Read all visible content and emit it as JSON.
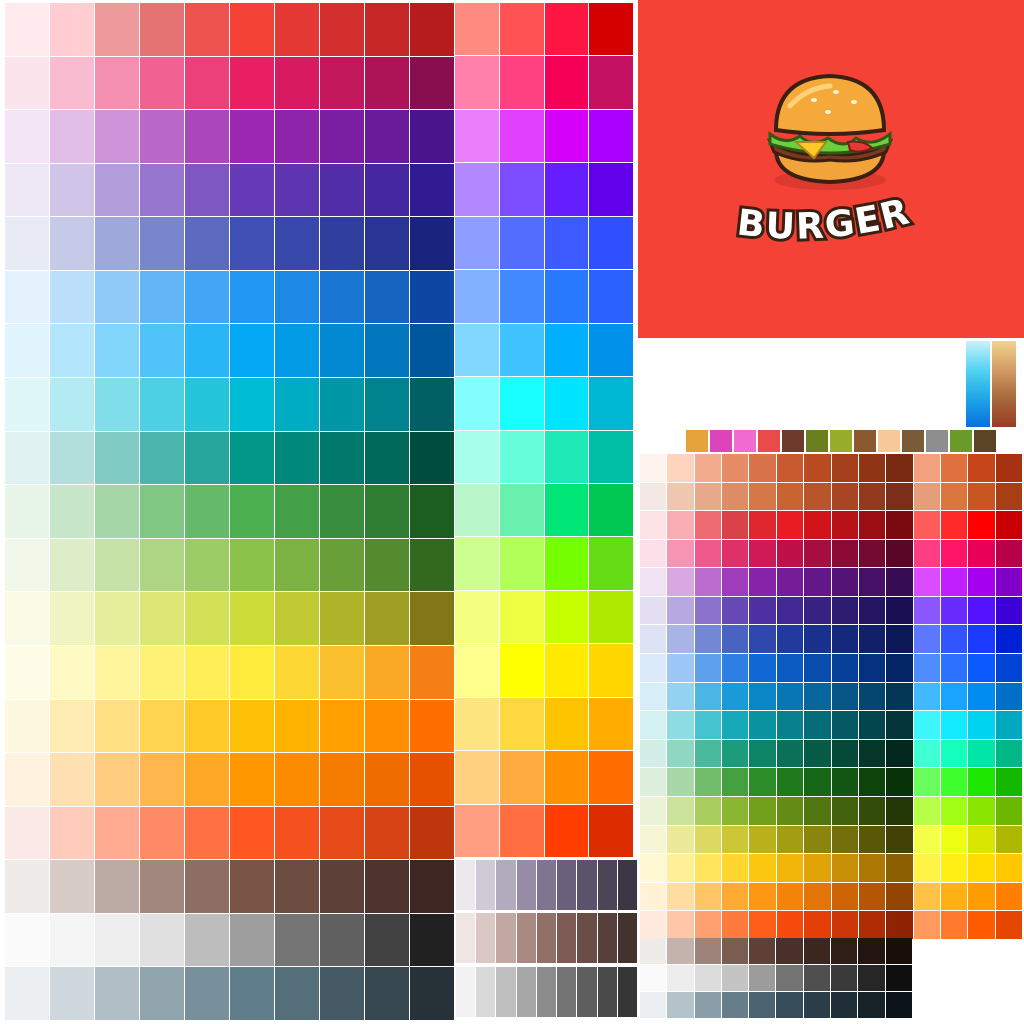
{
  "brand": {
    "name": "BURGER",
    "panel_color": "#f44336",
    "logo_icon": "burger-icon"
  },
  "gradients": [
    {
      "name": "blue-gradient",
      "from": "#c9f3fb",
      "to": "#0a6fe0"
    },
    {
      "name": "tan-gradient",
      "from": "#f1d48a",
      "to": "#9a3b22"
    }
  ],
  "swatch_strip": [
    "#e5a13a",
    "#dd44bb",
    "#f06ad2",
    "#ea4a4a",
    "#6e3a2a",
    "#6b7f1f",
    "#98ae2a",
    "#8a5a2e",
    "#f7c89a",
    "#7a5a38",
    "#8e8e8e",
    "#6a9a28",
    "#5a4426"
  ],
  "main_palette": {
    "columns": 10,
    "rows": [
      [
        "#ffebee",
        "#ffcdd2",
        "#ef9a9a",
        "#e57373",
        "#ef5350",
        "#f44336",
        "#e53935",
        "#d32f2f",
        "#c62828",
        "#b71c1c"
      ],
      [
        "#fce4ec",
        "#f8bbd0",
        "#f48fb1",
        "#f06292",
        "#ec407a",
        "#e91e63",
        "#d81b60",
        "#c2185b",
        "#ad1457",
        "#880e4f"
      ],
      [
        "#f3e5f5",
        "#e1bee7",
        "#ce93d8",
        "#ba68c8",
        "#ab47bc",
        "#9c27b0",
        "#8e24aa",
        "#7b1fa2",
        "#6a1b9a",
        "#4a148c"
      ],
      [
        "#ede7f6",
        "#d1c4e9",
        "#b39ddb",
        "#9575cd",
        "#7e57c2",
        "#673ab7",
        "#5e35b1",
        "#512da8",
        "#4527a0",
        "#311b92"
      ],
      [
        "#e8eaf6",
        "#c5cae9",
        "#9fa8da",
        "#7986cb",
        "#5c6bc0",
        "#3f51b5",
        "#3949ab",
        "#303f9f",
        "#283593",
        "#1a237e"
      ],
      [
        "#e3f2fd",
        "#bbdefb",
        "#90caf9",
        "#64b5f6",
        "#42a5f5",
        "#2196f3",
        "#1e88e5",
        "#1976d2",
        "#1565c0",
        "#0d47a1"
      ],
      [
        "#e1f5fe",
        "#b3e5fc",
        "#81d4fa",
        "#4fc3f7",
        "#29b6f6",
        "#03a9f4",
        "#039be5",
        "#0288d1",
        "#0277bd",
        "#01579b"
      ],
      [
        "#e0f7fa",
        "#b2ebf2",
        "#80deea",
        "#4dd0e1",
        "#26c6da",
        "#00bcd4",
        "#00acc1",
        "#0097a7",
        "#00838f",
        "#006064"
      ],
      [
        "#e0f2f1",
        "#b2dfdb",
        "#80cbc4",
        "#4db6ac",
        "#26a69a",
        "#009688",
        "#00897b",
        "#00796b",
        "#00695c",
        "#004d40"
      ],
      [
        "#e8f5e9",
        "#c8e6c9",
        "#a5d6a7",
        "#81c784",
        "#66bb6a",
        "#4caf50",
        "#43a047",
        "#388e3c",
        "#2e7d32",
        "#1b5e20"
      ],
      [
        "#f1f8e9",
        "#dcedc8",
        "#c5e1a5",
        "#aed581",
        "#9ccc65",
        "#8bc34a",
        "#7cb342",
        "#689f38",
        "#558b2f",
        "#33691e"
      ],
      [
        "#f9fbe7",
        "#f0f4c3",
        "#e6ee9c",
        "#dce775",
        "#d4e157",
        "#cddc39",
        "#c0ca33",
        "#afb42b",
        "#9e9d24",
        "#827717"
      ],
      [
        "#fffde7",
        "#fff9c4",
        "#fff59d",
        "#fff176",
        "#ffee58",
        "#ffeb3b",
        "#fdd835",
        "#fbc02d",
        "#f9a825",
        "#f57f17"
      ],
      [
        "#fff8e1",
        "#ffecb3",
        "#ffe082",
        "#ffd54f",
        "#ffca28",
        "#ffc107",
        "#ffb300",
        "#ffa000",
        "#ff8f00",
        "#ff6f00"
      ],
      [
        "#fff3e0",
        "#ffe0b2",
        "#ffcc80",
        "#ffb74d",
        "#ffa726",
        "#ff9800",
        "#fb8c00",
        "#f57c00",
        "#ef6c00",
        "#e65100"
      ],
      [
        "#fbe9e7",
        "#ffccbc",
        "#ffab91",
        "#ff8a65",
        "#ff7043",
        "#ff5722",
        "#f4511e",
        "#e64a19",
        "#d84315",
        "#bf360c"
      ],
      [
        "#efebe9",
        "#d7ccc8",
        "#bcaaa4",
        "#a1887f",
        "#8d6e63",
        "#795548",
        "#6d4c41",
        "#5d4037",
        "#4e342e",
        "#3e2723"
      ],
      [
        "#fafafa",
        "#f5f5f5",
        "#eeeeee",
        "#e0e0e0",
        "#bdbdbd",
        "#9e9e9e",
        "#757575",
        "#616161",
        "#424242",
        "#212121"
      ],
      [
        "#eceff1",
        "#cfd8dc",
        "#b0bec5",
        "#90a4ae",
        "#78909c",
        "#607d8b",
        "#546e7a",
        "#455a64",
        "#37474f",
        "#263238"
      ]
    ]
  },
  "accent_palette": {
    "columns": 4,
    "rows": [
      [
        "#ff8a80",
        "#ff5252",
        "#ff1744",
        "#d50000"
      ],
      [
        "#ff80ab",
        "#ff4081",
        "#f50057",
        "#c51162"
      ],
      [
        "#ea80fc",
        "#e040fb",
        "#d500f9",
        "#aa00ff"
      ],
      [
        "#b388ff",
        "#7c4dff",
        "#651fff",
        "#6200ea"
      ],
      [
        "#8c9eff",
        "#536dfe",
        "#3d5afe",
        "#304ffe"
      ],
      [
        "#82b1ff",
        "#448aff",
        "#2979ff",
        "#2962ff"
      ],
      [
        "#80d8ff",
        "#40c4ff",
        "#00b0ff",
        "#0091ea"
      ],
      [
        "#84ffff",
        "#18ffff",
        "#00e5ff",
        "#00b8d4"
      ],
      [
        "#a7ffeb",
        "#64ffda",
        "#1de9b6",
        "#00bfa5"
      ],
      [
        "#b9f6ca",
        "#69f0ae",
        "#00e676",
        "#00c853"
      ],
      [
        "#ccff90",
        "#b2ff59",
        "#76ff03",
        "#64dd17"
      ],
      [
        "#f4ff81",
        "#eeff41",
        "#c6ff00",
        "#aeea00"
      ],
      [
        "#ffff8d",
        "#ffff00",
        "#ffea00",
        "#ffd600"
      ],
      [
        "#ffe57f",
        "#ffd740",
        "#ffc400",
        "#ffab00"
      ],
      [
        "#ffd180",
        "#ffab40",
        "#ff9100",
        "#ff6d00"
      ],
      [
        "#ff9e80",
        "#ff6e40",
        "#ff3d00",
        "#dd2c00"
      ]
    ]
  },
  "small_gray_palette": {
    "columns": 9,
    "rows": [
      [
        "#ebe9ee",
        "#cfcad6",
        "#b2abbd",
        "#968ca5",
        "#7f7491",
        "#6a607c",
        "#5b536c",
        "#4c4558",
        "#3c3745"
      ],
      [
        "#efe6e4",
        "#d9c8c4",
        "#c1a8a2",
        "#a88a82",
        "#927068",
        "#7d5a53",
        "#6b4d47",
        "#57403b",
        "#43322e"
      ],
      [
        "#f2f2f2",
        "#d9d9d9",
        "#bfbfbf",
        "#a6a6a6",
        "#8c8c8c",
        "#737373",
        "#5e5e5e",
        "#4a4a4a",
        "#363636"
      ]
    ]
  },
  "right_palette": {
    "columns": 14,
    "rows": [
      [
        "#fff3ee",
        "#ffd4bf",
        "#f2ab8c",
        "#e68c66",
        "#d9734b",
        "#c9592e",
        "#b94b22",
        "#a53e1b",
        "#8f3415",
        "#7a2a10",
        "#f2a07d",
        "#e0703e",
        "#c7451a",
        "#a8320f"
      ],
      [
        "#f4e8e4",
        "#efc7b0",
        "#e7a98a",
        "#dd8c66",
        "#d57847",
        "#c86332",
        "#b9552b",
        "#a84624",
        "#93391d",
        "#7d2e18",
        "#e59d7a",
        "#d9773e",
        "#c75620",
        "#a63f15"
      ],
      [
        "#fde3e6",
        "#f9aeb6",
        "#ee6b74",
        "#d94249",
        "#e0272d",
        "#ea1c23",
        "#d3131a",
        "#b71016",
        "#9a0d12",
        "#7a0a0e",
        "#ff5c5c",
        "#ff2a2a",
        "#ff0000",
        "#c80000"
      ],
      [
        "#fcdfe8",
        "#f595b3",
        "#ed5a8b",
        "#e03069",
        "#d01a57",
        "#c0104a",
        "#a60d41",
        "#8d0a37",
        "#740a30",
        "#5a0727",
        "#ff3d82",
        "#ff1466",
        "#e80058",
        "#b80048"
      ],
      [
        "#f0e1f3",
        "#d8a8e2",
        "#bb6ccf",
        "#9f3cba",
        "#8723a8",
        "#751c98",
        "#641788",
        "#541377",
        "#451066",
        "#360c53",
        "#d94dff",
        "#c21fff",
        "#a500f0",
        "#8000c8"
      ],
      [
        "#e4def2",
        "#b8a8e0",
        "#8c72cb",
        "#6749b6",
        "#4e30a3",
        "#412893",
        "#372183",
        "#2d1b72",
        "#241562",
        "#1a0f50",
        "#8a56ff",
        "#6a2bff",
        "#5412ff",
        "#3d00d6"
      ],
      [
        "#dde2f4",
        "#a8b4e6",
        "#7487d4",
        "#4a62c2",
        "#3048ae",
        "#223a9e",
        "#1b318e",
        "#15297c",
        "#10216a",
        "#0a1857",
        "#5d78ff",
        "#3355ff",
        "#1a3bff",
        "#0020d6"
      ],
      [
        "#dbeafb",
        "#9cc6f5",
        "#5ea0ec",
        "#2d7fe3",
        "#1167d4",
        "#0b5ac2",
        "#084cad",
        "#063f97",
        "#053280",
        "#032566",
        "#4f8dff",
        "#2a72ff",
        "#0a5aff",
        "#0044d6"
      ],
      [
        "#d7eef9",
        "#93d3f1",
        "#4bb5e6",
        "#1a9ad9",
        "#0a86c7",
        "#0876b3",
        "#06669d",
        "#055686",
        "#04466e",
        "#033655",
        "#42b8ff",
        "#1aa3ff",
        "#008cf0",
        "#006fc8"
      ],
      [
        "#d3f0f3",
        "#8ddce3",
        "#45c4cf",
        "#16a9b8",
        "#0b93a2",
        "#08808d",
        "#066c78",
        "#055963",
        "#04464e",
        "#033439",
        "#3ef6ff",
        "#14ebff",
        "#00d4f0",
        "#00a8c0"
      ],
      [
        "#d2eee7",
        "#8fd6c3",
        "#49bb9c",
        "#1c9c7a",
        "#0e8466",
        "#0a7057",
        "#075c48",
        "#054939",
        "#04362a",
        "#03261d",
        "#40ffd2",
        "#14ffbd",
        "#00e6a8",
        "#00b886"
      ],
      [
        "#dcefdc",
        "#a8d8a6",
        "#72bd6c",
        "#45a13f",
        "#2c8c27",
        "#1f7a1c",
        "#176816",
        "#115611",
        "#0c440c",
        "#083208",
        "#68ff5e",
        "#3fff2e",
        "#1de600",
        "#14b800"
      ],
      [
        "#eaf3d5",
        "#cbe39b",
        "#a9ce5f",
        "#8ab632",
        "#73a01b",
        "#638c14",
        "#527610",
        "#42610c",
        "#334c09",
        "#243706",
        "#b8ff47",
        "#a0ff14",
        "#8ae600",
        "#6cb800"
      ],
      [
        "#f7f6d4",
        "#ece99b",
        "#ddd862",
        "#cdc636",
        "#b9b21c",
        "#a39d14",
        "#8b8510",
        "#736e0c",
        "#5b5709",
        "#444106",
        "#f4ff47",
        "#eeff14",
        "#d9e600",
        "#aeb800"
      ],
      [
        "#fff8d2",
        "#fff098",
        "#ffe45c",
        "#ffd62d",
        "#fcc711",
        "#f2b60a",
        "#e0a308",
        "#c88e06",
        "#ae7805",
        "#8d5f03",
        "#fff347",
        "#ffef14",
        "#ffdd00",
        "#ffc800"
      ],
      [
        "#fff2d6",
        "#ffdca0",
        "#ffc466",
        "#ffab33",
        "#fd9612",
        "#f5850a",
        "#e47508",
        "#cd6506",
        "#b45605",
        "#944503",
        "#ffc247",
        "#ffb014",
        "#ff9c00",
        "#ff8000"
      ],
      [
        "#ffe9dc",
        "#ffc7a8",
        "#ffa070",
        "#ff7a3d",
        "#ff5e1a",
        "#f74b0d",
        "#e53f09",
        "#cc3507",
        "#b02c05",
        "#902303",
        "#ff9a5e",
        "#ff7a2e",
        "#ff5c00",
        "#e64700"
      ]
    ]
  },
  "right_gray_palette": {
    "columns": 10,
    "rows": [
      [
        "#efebe9",
        "#c3b3ac",
        "#9d847a",
        "#7a5c51",
        "#5e4037",
        "#4a3029",
        "#3c2620",
        "#2f1d18",
        "#241511",
        "#1a0e0b"
      ],
      [
        "#fafafa",
        "#ededed",
        "#dcdcdc",
        "#c4c4c4",
        "#9c9c9c",
        "#737373",
        "#4f4f4f",
        "#3a3a3a",
        "#262626",
        "#0f0f0f"
      ],
      [
        "#eceff1",
        "#b4c2ca",
        "#8a9ea9",
        "#667d8a",
        "#4b6270",
        "#364c59",
        "#2a3d48",
        "#1f2e37",
        "#162128",
        "#0c141a"
      ]
    ]
  }
}
